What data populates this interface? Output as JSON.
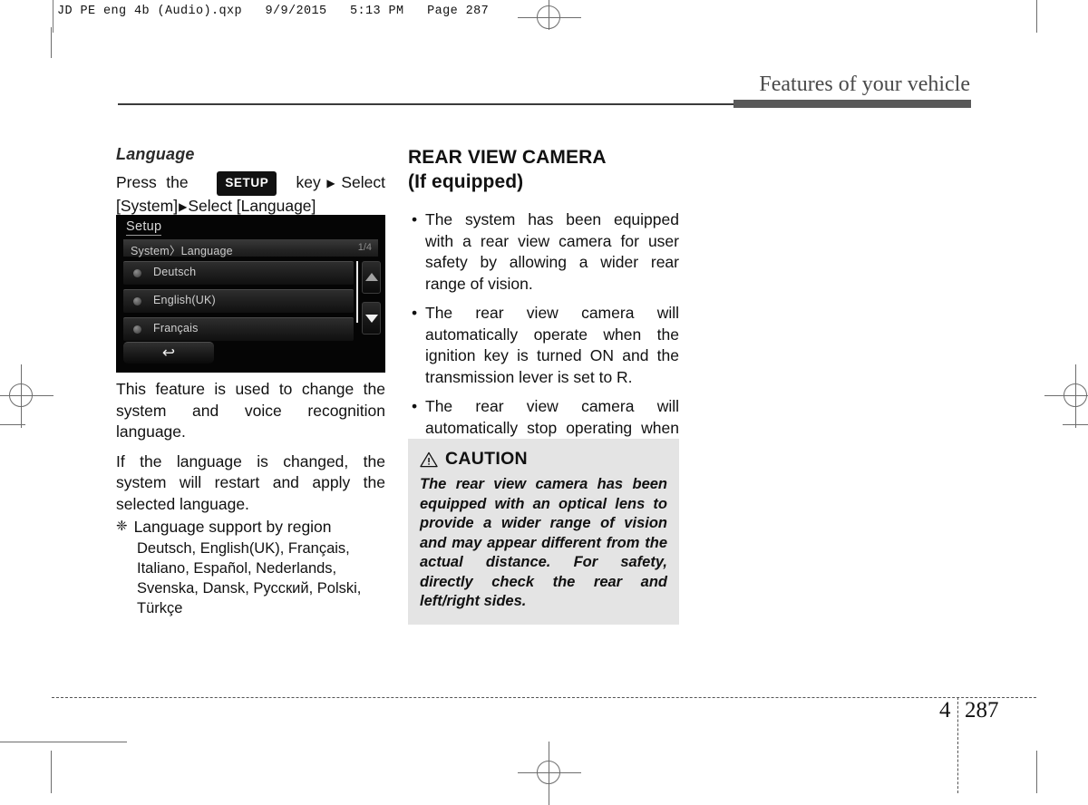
{
  "print_marks": {
    "file_header": "JD PE eng 4b (Audio).qxp   9/9/2015   5:13 PM   Page 287"
  },
  "running_head": {
    "title": "Features of your vehicle"
  },
  "left_column": {
    "sub_heading": "Language",
    "instruction": {
      "before_key": "Press    the",
      "key_label": "SETUP",
      "after_key": "key",
      "arrow": "▶",
      "step_2": "Select [System]",
      "step_3": "Select [Language]"
    },
    "device_screen": {
      "title": "Setup",
      "breadcrumb": "System〉Language",
      "page_indicator": "1/4",
      "options": [
        {
          "label": "Deutsch"
        },
        {
          "label": "English(UK)"
        },
        {
          "label": "Français"
        }
      ],
      "scroll_up": "▲",
      "scroll_down": "▼",
      "back_glyph": "↩"
    },
    "paragraphs": [
      "This feature is used to change the system and voice recognition language.",
      "If the language is changed, the system will restart and apply the selected language."
    ],
    "note": {
      "symbol": "❈",
      "heading": "Language support by region",
      "body": "Deutsch, English(UK), Français, Italiano, Español, Nederlands, Svenska, Dansk, Русский, Polski, Türkçe"
    }
  },
  "right_column": {
    "heading_line1": "REAR VIEW CAMERA",
    "heading_line2": "(If equipped)",
    "bullet_symbol": "•",
    "bullets": [
      "The system has been equipped with a rear view camera for user safety by allowing a wider rear range of vision.",
      "The rear view camera will automatically operate when the ignition key is turned ON and the transmission lever is set to R.",
      "The rear view camera will automatically stop operating when set to a different lever."
    ],
    "caution": {
      "title": "CAUTION",
      "icon_glyph": "!",
      "text": "The rear view camera has been equipped with an optical lens to provide a wider range of vision and may appear different from the actual distance. For safety, directly check the rear and left/right sides."
    }
  },
  "footer": {
    "chapter": "4",
    "page": "287"
  }
}
